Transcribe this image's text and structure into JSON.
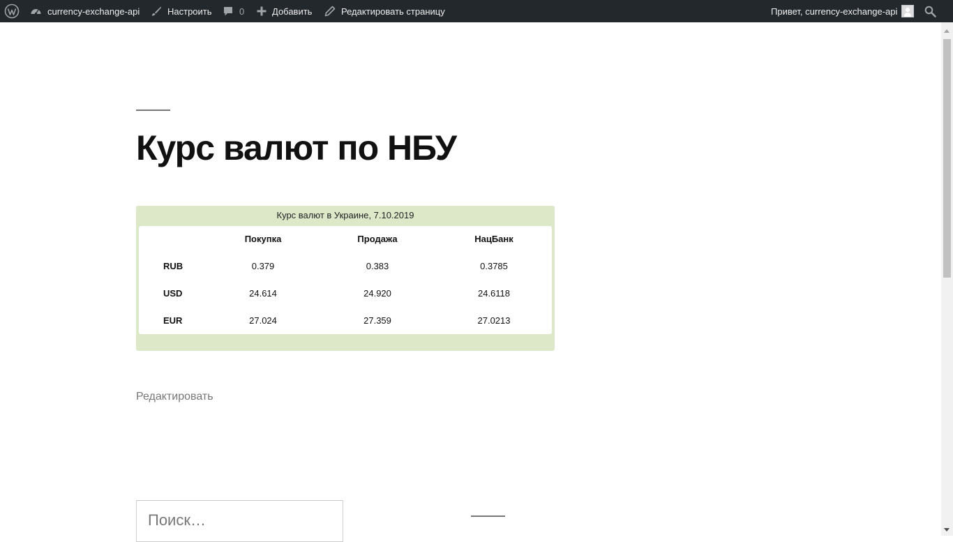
{
  "admin_bar": {
    "site_name": "currency-exchange-api",
    "customize_label": "Настроить",
    "comments_count": "0",
    "add_label": "Добавить",
    "edit_page_label": "Редактировать страницу",
    "greeting": "Привет, currency-exchange-api",
    "icons": [
      "wordpress-logo-icon",
      "dashboard-icon",
      "brush-icon",
      "comment-icon",
      "plus-icon",
      "pencil-icon",
      "avatar",
      "search-icon"
    ]
  },
  "page": {
    "title": "Курс валют по НБУ",
    "edit_link": "Редактировать"
  },
  "rates_widget": {
    "caption": "Курс валют в Украине, 7.10.2019",
    "columns": [
      "Покупка",
      "Продажа",
      "НацБанк"
    ],
    "rows": [
      {
        "code": "RUB",
        "buy": "0.379",
        "sell": "0.383",
        "nbu": "0.3785"
      },
      {
        "code": "USD",
        "buy": "24.614",
        "sell": "24.920",
        "nbu": "24.6118"
      },
      {
        "code": "EUR",
        "buy": "27.024",
        "sell": "27.359",
        "nbu": "27.0213"
      }
    ],
    "colors": {
      "frame": "#dce8c8",
      "inner": "#ffffff"
    }
  },
  "search": {
    "placeholder": "Поиск…"
  },
  "colors": {
    "admin_bar_bg": "#23282d",
    "admin_bar_text": "#eeeeee",
    "muted_text": "#767676"
  }
}
